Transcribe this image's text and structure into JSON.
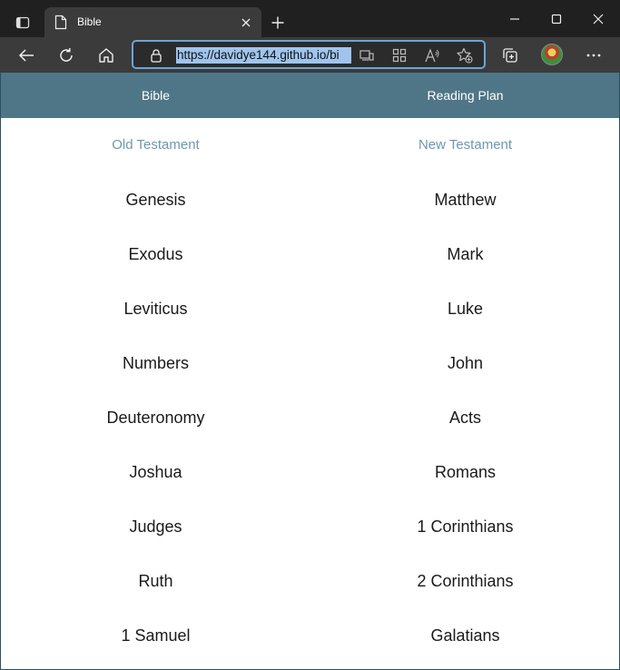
{
  "browser": {
    "tab_title": "Bible",
    "url": "https://davidye144.github.io/bi",
    "icons": {
      "tab_actions": "tab-actions-icon",
      "page": "page-icon",
      "tab_close": "close-icon",
      "new_tab": "plus-icon",
      "minimize": "minimize-icon",
      "maximize": "maximize-icon",
      "close": "close-icon",
      "back": "back-arrow-icon",
      "refresh": "refresh-icon",
      "home": "home-icon",
      "lock": "lock-icon",
      "app_available": "app-install-icon",
      "immersive_reader": "immersive-reader-icon",
      "read_aloud": "read-aloud-icon",
      "favorite": "add-favorite-icon",
      "collections": "collections-icon",
      "profile": "profile-avatar",
      "more": "more-icon"
    }
  },
  "nav": {
    "bible": "Bible",
    "reading_plan": "Reading Plan"
  },
  "old_testament": {
    "heading": "Old Testament",
    "books": [
      "Genesis",
      "Exodus",
      "Leviticus",
      "Numbers",
      "Deuteronomy",
      "Joshua",
      "Judges",
      "Ruth",
      "1 Samuel"
    ]
  },
  "new_testament": {
    "heading": "New Testament",
    "books": [
      "Matthew",
      "Mark",
      "Luke",
      "John",
      "Acts",
      "Romans",
      "1 Corinthians",
      "2 Corinthians",
      "Galatians"
    ]
  },
  "colors": {
    "nav_bg": "#4f7687",
    "heading": "#6f97ad",
    "url_highlight": "#9fc5ee",
    "address_border": "#6aa6d8"
  }
}
